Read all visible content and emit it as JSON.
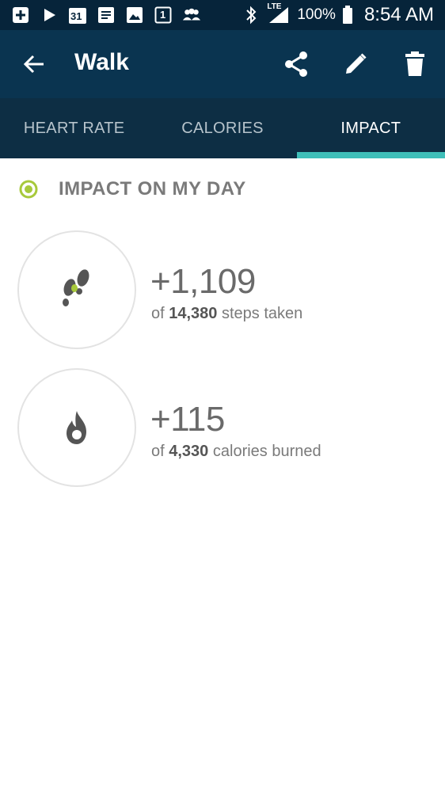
{
  "status_bar": {
    "icons": [
      "plus-box-icon",
      "play-icon",
      "calendar-icon",
      "notes-icon",
      "image-icon",
      "calendar-day-icon",
      "group-icon",
      "bluetooth-icon",
      "lte-signal-icon",
      "battery-icon"
    ],
    "calendar_day": "31",
    "day_one": "1",
    "lte": "LTE",
    "battery": "100%",
    "time": "8:54 AM"
  },
  "app_bar": {
    "title": "Walk",
    "actions": [
      "share-icon",
      "edit-icon",
      "delete-icon"
    ]
  },
  "tabs": [
    {
      "label": "HEART RATE",
      "active": false
    },
    {
      "label": "CALORIES",
      "active": false
    },
    {
      "label": "IMPACT",
      "active": true
    }
  ],
  "section": {
    "title": "IMPACT ON MY DAY"
  },
  "stats": [
    {
      "icon": "footsteps-icon",
      "value": "+1,109",
      "prefix": "of",
      "total": "14,380",
      "suffix": "steps taken"
    },
    {
      "icon": "flame-icon",
      "value": "+115",
      "prefix": "of",
      "total": "4,330",
      "suffix": "calories burned"
    }
  ],
  "colors": {
    "status_bar": "#06243a",
    "app_bar": "#0a3450",
    "tab_bar": "#0d2e44",
    "tab_indicator": "#3fbfb9",
    "accent_green": "#a7c93b"
  }
}
